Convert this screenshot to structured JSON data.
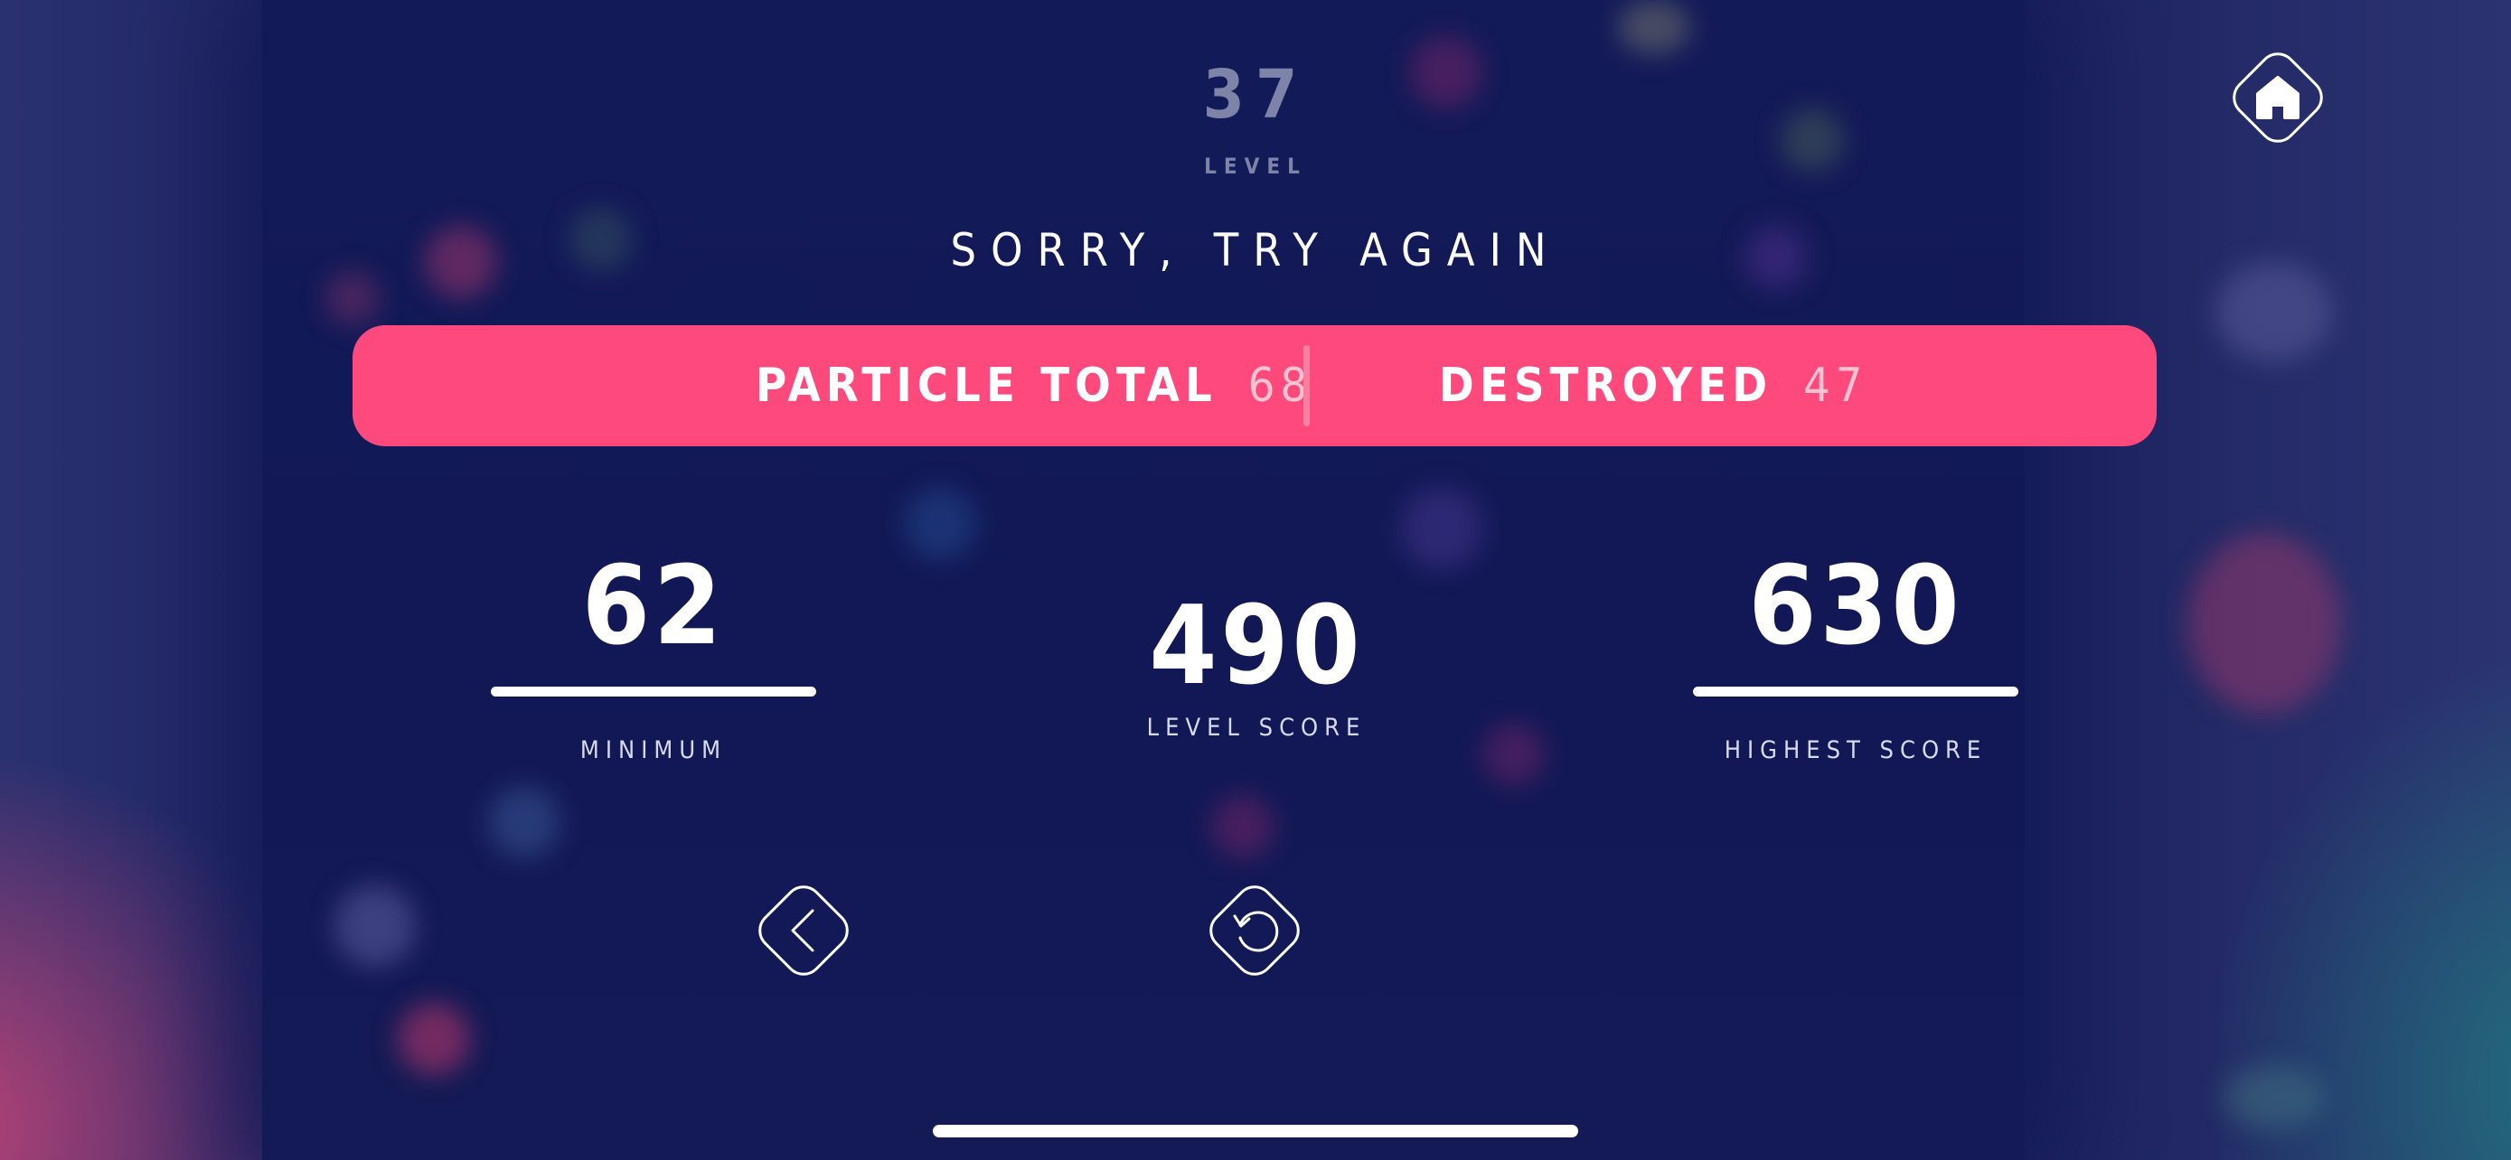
{
  "level": {
    "number": "37",
    "label": "LEVEL"
  },
  "result": {
    "headline": "SORRY, TRY AGAIN"
  },
  "summary_bar": {
    "particle_total_label": "PARTICLE TOTAL",
    "particle_total_value": "68",
    "destroyed_label": "DESTROYED",
    "destroyed_value": "47"
  },
  "stats": {
    "minimum": {
      "value": "62",
      "label": "MINIMUM"
    },
    "level_score": {
      "value": "490",
      "label": "LEVEL SCORE"
    },
    "highest_score": {
      "value": "630",
      "label": "HIGHEST SCORE"
    }
  },
  "buttons": {
    "home_icon": "home-icon",
    "back_icon": "chevron-left-icon",
    "retry_icon": "retry-icon"
  },
  "colors": {
    "accent_pink": "#fe497c",
    "background_navy": "#131a58",
    "muted_text": "#7e83a8"
  }
}
